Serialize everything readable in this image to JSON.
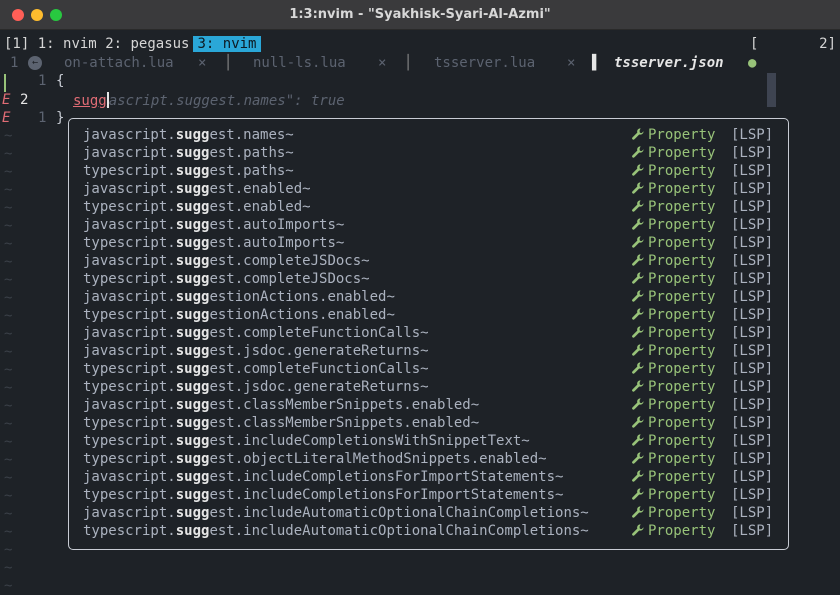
{
  "window": {
    "title": "1:3:nvim - \"Syakhisk-Syari-Al-Azmi\""
  },
  "tmux": {
    "session": "[1]",
    "windows": [
      "1: nvim",
      "2: pegasus"
    ],
    "active_window": "3: nvim",
    "right_bracket": "[",
    "right_count": "2]"
  },
  "bufferline": {
    "number": "1",
    "tabs": [
      {
        "name": "on-attach.lua",
        "close": "×",
        "active": false
      },
      {
        "name": "null-ls.lua",
        "close": "×",
        "active": false
      },
      {
        "name": "tsserver.lua",
        "close": "×",
        "active": false
      },
      {
        "name": "tsserver.json",
        "modified": "●",
        "active": true
      }
    ]
  },
  "editor": {
    "lines": [
      {
        "sign": "",
        "number": "1",
        "text": "{"
      },
      {
        "sign": "E",
        "number": "2",
        "typed": "sugg",
        "ghost": "ascript.suggest.names\": true"
      },
      {
        "sign": "E",
        "number": "1",
        "text": "}"
      }
    ]
  },
  "completion": {
    "match": "sugg",
    "kind_icon": "wrench-icon",
    "items": [
      {
        "pre": "javascript.",
        "match": "sugg",
        "post": "est.names~",
        "kind": "Property",
        "source": "[LSP]"
      },
      {
        "pre": "javascript.",
        "match": "sugg",
        "post": "est.paths~",
        "kind": "Property",
        "source": "[LSP]"
      },
      {
        "pre": "typescript.",
        "match": "sugg",
        "post": "est.paths~",
        "kind": "Property",
        "source": "[LSP]"
      },
      {
        "pre": "javascript.",
        "match": "sugg",
        "post": "est.enabled~",
        "kind": "Property",
        "source": "[LSP]"
      },
      {
        "pre": "typescript.",
        "match": "sugg",
        "post": "est.enabled~",
        "kind": "Property",
        "source": "[LSP]"
      },
      {
        "pre": "javascript.",
        "match": "sugg",
        "post": "est.autoImports~",
        "kind": "Property",
        "source": "[LSP]"
      },
      {
        "pre": "typescript.",
        "match": "sugg",
        "post": "est.autoImports~",
        "kind": "Property",
        "source": "[LSP]"
      },
      {
        "pre": "javascript.",
        "match": "sugg",
        "post": "est.completeJSDocs~",
        "kind": "Property",
        "source": "[LSP]"
      },
      {
        "pre": "typescript.",
        "match": "sugg",
        "post": "est.completeJSDocs~",
        "kind": "Property",
        "source": "[LSP]"
      },
      {
        "pre": "javascript.",
        "match": "sugg",
        "post": "estionActions.enabled~",
        "kind": "Property",
        "source": "[LSP]"
      },
      {
        "pre": "typescript.",
        "match": "sugg",
        "post": "estionActions.enabled~",
        "kind": "Property",
        "source": "[LSP]"
      },
      {
        "pre": "javascript.",
        "match": "sugg",
        "post": "est.completeFunctionCalls~",
        "kind": "Property",
        "source": "[LSP]"
      },
      {
        "pre": "javascript.",
        "match": "sugg",
        "post": "est.jsdoc.generateReturns~",
        "kind": "Property",
        "source": "[LSP]"
      },
      {
        "pre": "typescript.",
        "match": "sugg",
        "post": "est.completeFunctionCalls~",
        "kind": "Property",
        "source": "[LSP]"
      },
      {
        "pre": "typescript.",
        "match": "sugg",
        "post": "est.jsdoc.generateReturns~",
        "kind": "Property",
        "source": "[LSP]"
      },
      {
        "pre": "javascript.",
        "match": "sugg",
        "post": "est.classMemberSnippets.enabled~",
        "kind": "Property",
        "source": "[LSP]"
      },
      {
        "pre": "typescript.",
        "match": "sugg",
        "post": "est.classMemberSnippets.enabled~",
        "kind": "Property",
        "source": "[LSP]"
      },
      {
        "pre": "typescript.",
        "match": "sugg",
        "post": "est.includeCompletionsWithSnippetText~",
        "kind": "Property",
        "source": "[LSP]"
      },
      {
        "pre": "typescript.",
        "match": "sugg",
        "post": "est.objectLiteralMethodSnippets.enabled~",
        "kind": "Property",
        "source": "[LSP]"
      },
      {
        "pre": "javascript.",
        "match": "sugg",
        "post": "est.includeCompletionsForImportStatements~",
        "kind": "Property",
        "source": "[LSP]"
      },
      {
        "pre": "typescript.",
        "match": "sugg",
        "post": "est.includeCompletionsForImportStatements~",
        "kind": "Property",
        "source": "[LSP]"
      },
      {
        "pre": "javascript.",
        "match": "sugg",
        "post": "est.includeAutomaticOptionalChainCompletions~",
        "kind": "Property",
        "source": "[LSP]"
      },
      {
        "pre": "typescript.",
        "match": "sugg",
        "post": "est.includeAutomaticOptionalChainCompletions~",
        "kind": "Property",
        "source": "[LSP]"
      }
    ]
  }
}
